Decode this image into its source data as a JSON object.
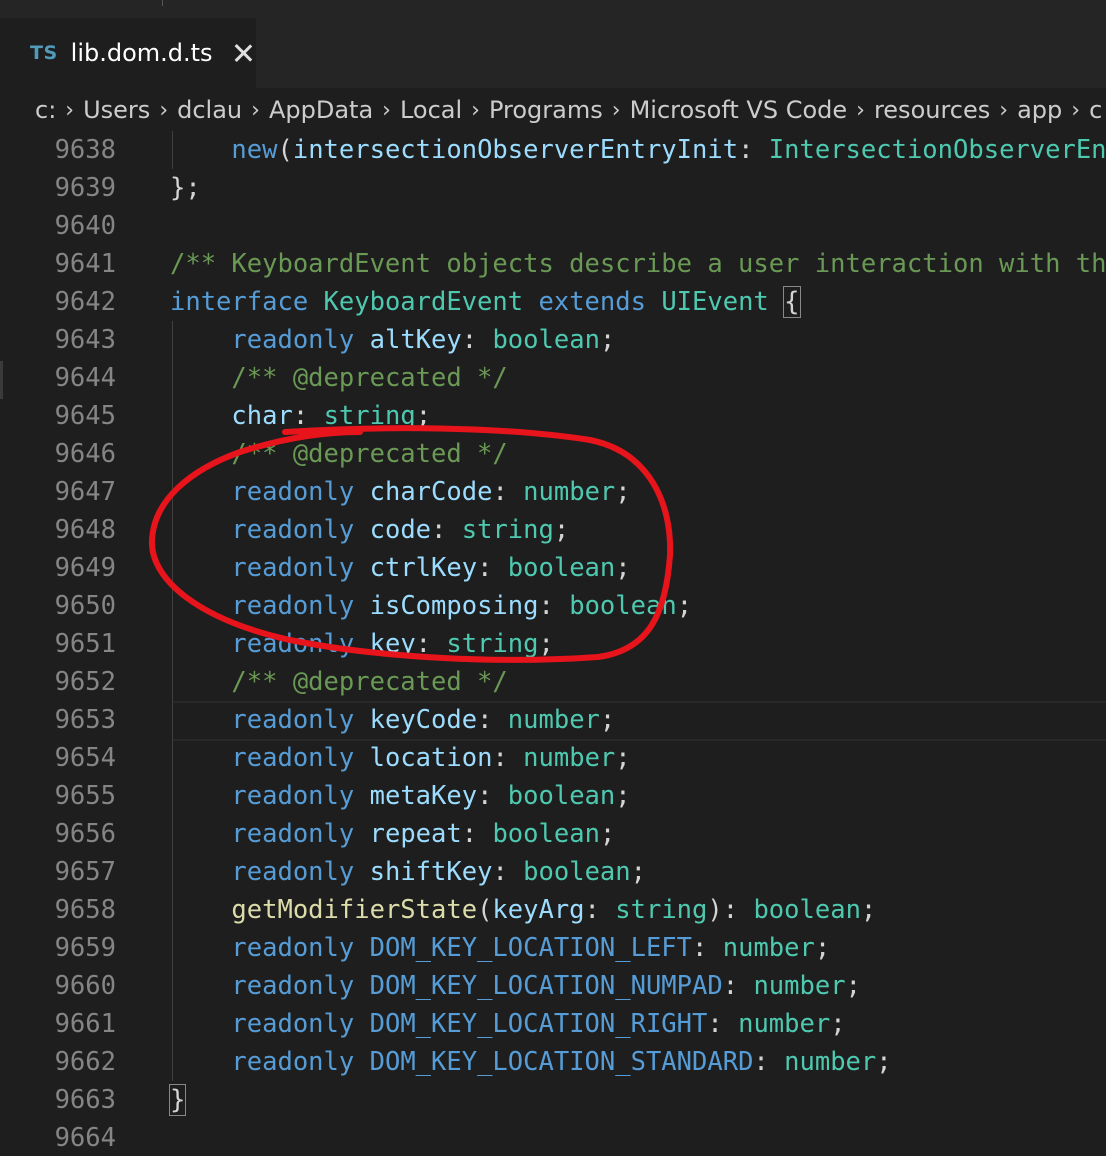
{
  "tab": {
    "icon_text": "TS",
    "title": "lib.dom.d.ts"
  },
  "breadcrumb": [
    "c:",
    "Users",
    "dclau",
    "AppData",
    "Local",
    "Programs",
    "Microsoft VS Code",
    "resources",
    "app",
    "c"
  ],
  "lines": [
    {
      "num": "9638",
      "tokens": [
        [
          "    ",
          "pun"
        ],
        [
          "new",
          "kw"
        ],
        [
          "(",
          "pun"
        ],
        [
          "intersectionObserverEntryInit",
          "prop"
        ],
        [
          ": ",
          "pun"
        ],
        [
          "IntersectionObserverEn",
          "type"
        ]
      ]
    },
    {
      "num": "9639",
      "tokens": [
        [
          "};",
          "pun"
        ]
      ]
    },
    {
      "num": "9640",
      "tokens": []
    },
    {
      "num": "9641",
      "tokens": [
        [
          "/** KeyboardEvent objects describe a user interaction with th",
          "cmt"
        ]
      ]
    },
    {
      "num": "9642",
      "tokens": [
        [
          "interface",
          "kw"
        ],
        [
          " ",
          "pun"
        ],
        [
          "KeyboardEvent",
          "type"
        ],
        [
          " ",
          "pun"
        ],
        [
          "extends",
          "kw"
        ],
        [
          " ",
          "pun"
        ],
        [
          "UIEvent",
          "type"
        ],
        [
          " ",
          "pun"
        ],
        [
          "{",
          "bracket"
        ]
      ]
    },
    {
      "num": "9643",
      "tokens": [
        [
          "    ",
          "pun"
        ],
        [
          "readonly",
          "kw"
        ],
        [
          " ",
          "pun"
        ],
        [
          "altKey",
          "prop"
        ],
        [
          ": ",
          "pun"
        ],
        [
          "boolean",
          "type"
        ],
        [
          ";",
          "pun"
        ]
      ]
    },
    {
      "num": "9644",
      "tokens": [
        [
          "    ",
          "pun"
        ],
        [
          "/** @deprecated */",
          "cmt"
        ]
      ]
    },
    {
      "num": "9645",
      "tokens": [
        [
          "    ",
          "pun"
        ],
        [
          "char",
          "prop"
        ],
        [
          ": ",
          "pun"
        ],
        [
          "string",
          "type"
        ],
        [
          ";",
          "pun"
        ]
      ]
    },
    {
      "num": "9646",
      "tokens": [
        [
          "    ",
          "pun"
        ],
        [
          "/** @deprecated */",
          "cmt"
        ]
      ]
    },
    {
      "num": "9647",
      "tokens": [
        [
          "    ",
          "pun"
        ],
        [
          "readonly",
          "kw"
        ],
        [
          " ",
          "pun"
        ],
        [
          "charCode",
          "prop"
        ],
        [
          ": ",
          "pun"
        ],
        [
          "number",
          "type"
        ],
        [
          ";",
          "pun"
        ]
      ]
    },
    {
      "num": "9648",
      "tokens": [
        [
          "    ",
          "pun"
        ],
        [
          "readonly",
          "kw"
        ],
        [
          " ",
          "pun"
        ],
        [
          "code",
          "prop"
        ],
        [
          ": ",
          "pun"
        ],
        [
          "string",
          "type"
        ],
        [
          ";",
          "pun"
        ]
      ]
    },
    {
      "num": "9649",
      "tokens": [
        [
          "    ",
          "pun"
        ],
        [
          "readonly",
          "kw"
        ],
        [
          " ",
          "pun"
        ],
        [
          "ctrlKey",
          "prop"
        ],
        [
          ": ",
          "pun"
        ],
        [
          "boolean",
          "type"
        ],
        [
          ";",
          "pun"
        ]
      ]
    },
    {
      "num": "9650",
      "tokens": [
        [
          "    ",
          "pun"
        ],
        [
          "readonly",
          "kw"
        ],
        [
          " ",
          "pun"
        ],
        [
          "isComposing",
          "prop"
        ],
        [
          ": ",
          "pun"
        ],
        [
          "boolean",
          "type"
        ],
        [
          ";",
          "pun"
        ]
      ]
    },
    {
      "num": "9651",
      "tokens": [
        [
          "    ",
          "pun"
        ],
        [
          "readonly",
          "kw"
        ],
        [
          " ",
          "pun"
        ],
        [
          "key",
          "prop"
        ],
        [
          ": ",
          "pun"
        ],
        [
          "string",
          "type"
        ],
        [
          ";",
          "pun"
        ]
      ]
    },
    {
      "num": "9652",
      "tokens": [
        [
          "    ",
          "pun"
        ],
        [
          "/** @deprecated */",
          "cmt"
        ]
      ]
    },
    {
      "num": "9653",
      "tokens": [
        [
          "    ",
          "pun"
        ],
        [
          "readonly",
          "kw"
        ],
        [
          " ",
          "pun"
        ],
        [
          "keyCode",
          "prop"
        ],
        [
          ": ",
          "pun"
        ],
        [
          "number",
          "type"
        ],
        [
          ";",
          "pun"
        ]
      ]
    },
    {
      "num": "9654",
      "tokens": [
        [
          "    ",
          "pun"
        ],
        [
          "readonly",
          "kw"
        ],
        [
          " ",
          "pun"
        ],
        [
          "location",
          "prop"
        ],
        [
          ": ",
          "pun"
        ],
        [
          "number",
          "type"
        ],
        [
          ";",
          "pun"
        ]
      ]
    },
    {
      "num": "9655",
      "tokens": [
        [
          "    ",
          "pun"
        ],
        [
          "readonly",
          "kw"
        ],
        [
          " ",
          "pun"
        ],
        [
          "metaKey",
          "prop"
        ],
        [
          ": ",
          "pun"
        ],
        [
          "boolean",
          "type"
        ],
        [
          ";",
          "pun"
        ]
      ]
    },
    {
      "num": "9656",
      "tokens": [
        [
          "    ",
          "pun"
        ],
        [
          "readonly",
          "kw"
        ],
        [
          " ",
          "pun"
        ],
        [
          "repeat",
          "prop"
        ],
        [
          ": ",
          "pun"
        ],
        [
          "boolean",
          "type"
        ],
        [
          ";",
          "pun"
        ]
      ]
    },
    {
      "num": "9657",
      "tokens": [
        [
          "    ",
          "pun"
        ],
        [
          "readonly",
          "kw"
        ],
        [
          " ",
          "pun"
        ],
        [
          "shiftKey",
          "prop"
        ],
        [
          ": ",
          "pun"
        ],
        [
          "boolean",
          "type"
        ],
        [
          ";",
          "pun"
        ]
      ]
    },
    {
      "num": "9658",
      "tokens": [
        [
          "    ",
          "pun"
        ],
        [
          "getModifierState",
          "func"
        ],
        [
          "(",
          "pun"
        ],
        [
          "keyArg",
          "prop"
        ],
        [
          ": ",
          "pun"
        ],
        [
          "string",
          "type"
        ],
        [
          "): ",
          "pun"
        ],
        [
          "boolean",
          "type"
        ],
        [
          ";",
          "pun"
        ]
      ]
    },
    {
      "num": "9659",
      "tokens": [
        [
          "    ",
          "pun"
        ],
        [
          "readonly",
          "kw"
        ],
        [
          " ",
          "pun"
        ],
        [
          "DOM_KEY_LOCATION_LEFT",
          "kw"
        ],
        [
          ": ",
          "pun"
        ],
        [
          "number",
          "type"
        ],
        [
          ";",
          "pun"
        ]
      ]
    },
    {
      "num": "9660",
      "tokens": [
        [
          "    ",
          "pun"
        ],
        [
          "readonly",
          "kw"
        ],
        [
          " ",
          "pun"
        ],
        [
          "DOM_KEY_LOCATION_NUMPAD",
          "kw"
        ],
        [
          ": ",
          "pun"
        ],
        [
          "number",
          "type"
        ],
        [
          ";",
          "pun"
        ]
      ]
    },
    {
      "num": "9661",
      "tokens": [
        [
          "    ",
          "pun"
        ],
        [
          "readonly",
          "kw"
        ],
        [
          " ",
          "pun"
        ],
        [
          "DOM_KEY_LOCATION_RIGHT",
          "kw"
        ],
        [
          ": ",
          "pun"
        ],
        [
          "number",
          "type"
        ],
        [
          ";",
          "pun"
        ]
      ]
    },
    {
      "num": "9662",
      "tokens": [
        [
          "    ",
          "pun"
        ],
        [
          "readonly",
          "kw"
        ],
        [
          " ",
          "pun"
        ],
        [
          "DOM_KEY_LOCATION_STANDARD",
          "kw"
        ],
        [
          ": ",
          "pun"
        ],
        [
          "number",
          "type"
        ],
        [
          ";",
          "pun"
        ]
      ]
    },
    {
      "num": "9663",
      "tokens": [
        [
          "}",
          "bracket"
        ]
      ]
    },
    {
      "num": "9664",
      "tokens": []
    }
  ],
  "colors": {
    "keyword": "#569cd6",
    "type": "#4ec9b0",
    "property": "#9cdcfe",
    "function": "#dcdcaa",
    "comment": "#6a9955",
    "annotation": "#e8141c"
  },
  "annotation": {
    "kind": "freehand-red-ellipse",
    "encloses_lines": [
      "9646",
      "9651"
    ]
  }
}
